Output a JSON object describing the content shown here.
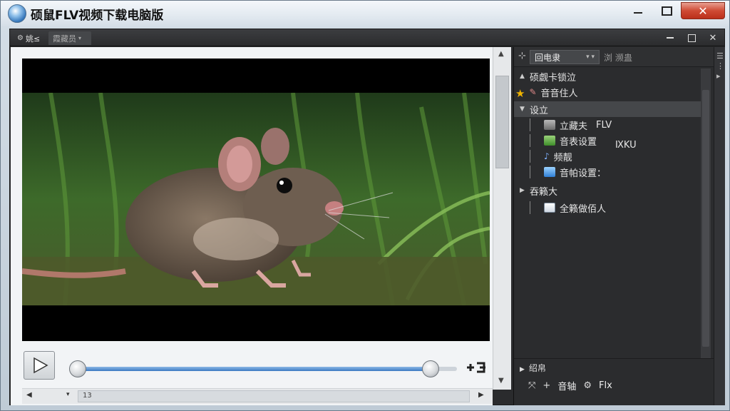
{
  "window": {
    "title": "硕鼠FLV视频下载电脑版",
    "close_glyph": "✕"
  },
  "inner": {
    "tab1_label": "姚≤",
    "tab2_label": "霞藏员",
    "close_glyph": "✕"
  },
  "sidebar": {
    "header_tab": "回电隶",
    "header_tab2": "浏 濒蛊",
    "items": [
      {
        "label": "硕觑卡锁泣"
      },
      {
        "label": "音音住人"
      },
      {
        "label": "设立"
      },
      {
        "label": "立藏夫",
        "extra": "FLV"
      },
      {
        "label": "音表设置",
        "extra": "ⅨKU"
      },
      {
        "label": "频靓 ",
        "extra": ""
      },
      {
        "label": "音帕设置："
      },
      {
        "label": "吞籁大"
      },
      {
        "label": "全籁做佰人"
      }
    ],
    "bottom_title": "绍帛",
    "bottom_items": [
      "音轴",
      "Flx"
    ]
  },
  "player": {
    "progress": 0.93,
    "status_time": "13"
  }
}
